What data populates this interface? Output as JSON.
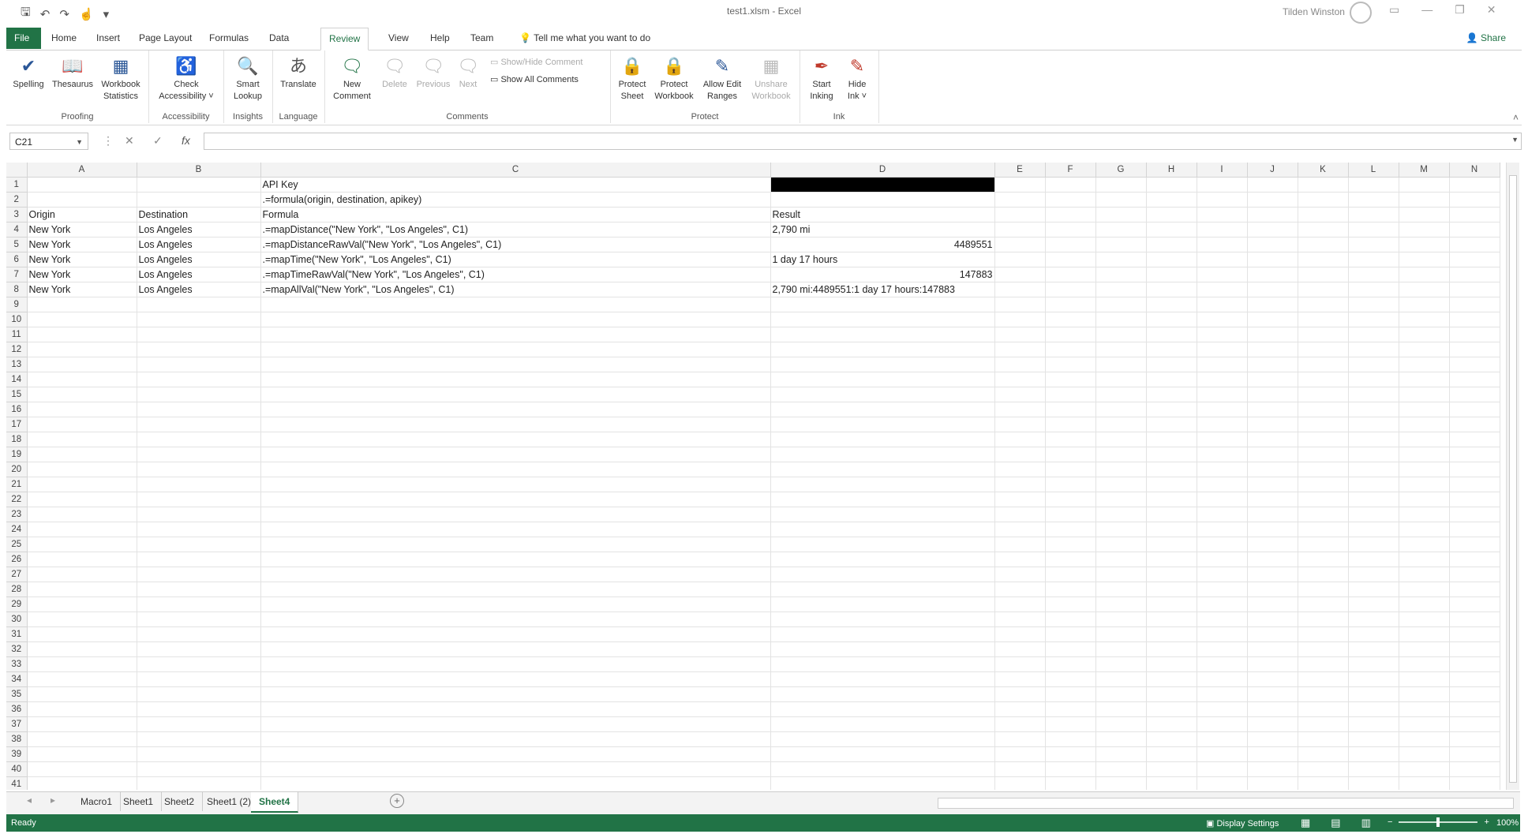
{
  "window": {
    "title": "test1.xlsm - Excel",
    "user": "Tilden Winston",
    "qat_icons": [
      "save-icon",
      "undo-icon",
      "redo-icon",
      "touch-mode-icon",
      "customize-icon"
    ]
  },
  "tabs": [
    {
      "label": "File"
    },
    {
      "label": "Home"
    },
    {
      "label": "Insert"
    },
    {
      "label": "Page Layout"
    },
    {
      "label": "Formulas"
    },
    {
      "label": "Data"
    },
    {
      "label": "Review"
    },
    {
      "label": "View"
    },
    {
      "label": "Help"
    },
    {
      "label": "Team"
    }
  ],
  "active_tab": "Review",
  "tell_me": "Tell me what you want to do",
  "share": "Share",
  "ribbon": {
    "proofing": {
      "label": "Proofing",
      "spelling": "Spelling",
      "thesaurus": "Thesaurus",
      "workbook_stats_1": "Workbook",
      "workbook_stats_2": "Statistics"
    },
    "accessibility": {
      "label": "Accessibility",
      "check_1": "Check",
      "check_2": "Accessibility ˅"
    },
    "insights": {
      "label": "Insights",
      "smart_1": "Smart",
      "smart_2": "Lookup"
    },
    "language": {
      "label": "Language",
      "translate": "Translate"
    },
    "comments": {
      "label": "Comments",
      "new_1": "New",
      "new_2": "Comment",
      "delete": "Delete",
      "previous": "Previous",
      "next": "Next",
      "show_hide": "Show/Hide Comment",
      "show_all": "Show All Comments"
    },
    "protect": {
      "label": "Protect",
      "protect_sheet_1": "Protect",
      "protect_sheet_2": "Sheet",
      "protect_wb_1": "Protect",
      "protect_wb_2": "Workbook",
      "allow_edit_1": "Allow Edit",
      "allow_edit_2": "Ranges",
      "unshare_1": "Unshare",
      "unshare_2": "Workbook"
    },
    "ink": {
      "label": "Ink",
      "start_1": "Start",
      "start_2": "Inking",
      "hide_1": "Hide",
      "hide_2": "Ink ˅"
    }
  },
  "formula_bar": {
    "name_box": "C21",
    "cancel": "✕",
    "enter": "✓",
    "fx": "fx",
    "value": ""
  },
  "columns": [
    "A",
    "B",
    "C",
    "D",
    "E",
    "F",
    "G",
    "H",
    "I",
    "J",
    "K",
    "L",
    "M",
    "N"
  ],
  "rows": [
    [
      "",
      "",
      "API Key",
      "",
      "",
      "",
      "",
      "",
      "",
      "",
      "",
      "",
      "",
      ""
    ],
    [
      "",
      "",
      ".=formula(origin, destination, apikey)",
      "",
      "",
      "",
      "",
      "",
      "",
      "",
      "",
      "",
      "",
      ""
    ],
    [
      "Origin",
      "Destination",
      "Formula",
      "Result",
      "",
      "",
      "",
      "",
      "",
      "",
      "",
      "",
      "",
      ""
    ],
    [
      "New York",
      "Los Angeles",
      ".=mapDistance(\"New York\", \"Los Angeles\", C1)",
      "2,790 mi",
      "",
      "",
      "",
      "",
      "",
      "",
      "",
      "",
      "",
      ""
    ],
    [
      "New York",
      "Los Angeles",
      ".=mapDistanceRawVal(\"New York\", \"Los Angeles\", C1)",
      "4489551",
      "",
      "",
      "",
      "",
      "",
      "",
      "",
      "",
      "",
      ""
    ],
    [
      "New York",
      "Los Angeles",
      ".=mapTime(\"New York\", \"Los Angeles\", C1)",
      "1 day 17 hours",
      "",
      "",
      "",
      "",
      "",
      "",
      "",
      "",
      "",
      ""
    ],
    [
      "New York",
      "Los Angeles",
      ".=mapTimeRawVal(\"New York\", \"Los Angeles\", C1)",
      "147883",
      "",
      "",
      "",
      "",
      "",
      "",
      "",
      "",
      "",
      ""
    ],
    [
      "New York",
      "Los Angeles",
      ".=mapAllVal(\"New York\", \"Los Angeles\", C1)",
      "2,790 mi:4489551:1 day 17 hours:147883",
      "",
      "",
      "",
      "",
      "",
      "",
      "",
      "",
      "",
      ""
    ]
  ],
  "total_rows": 41,
  "redacted_cell": "D1",
  "numeric_cells": [
    "D5",
    "D7"
  ],
  "sheet_tabs": [
    "Macro1",
    "Sheet1",
    "Sheet2",
    "Sheet1 (2)",
    "Sheet4"
  ],
  "active_sheet": "Sheet4",
  "status": {
    "ready": "Ready",
    "display_settings": "Display Settings",
    "zoom": "100%"
  },
  "colors": {
    "accent": "#217346"
  }
}
